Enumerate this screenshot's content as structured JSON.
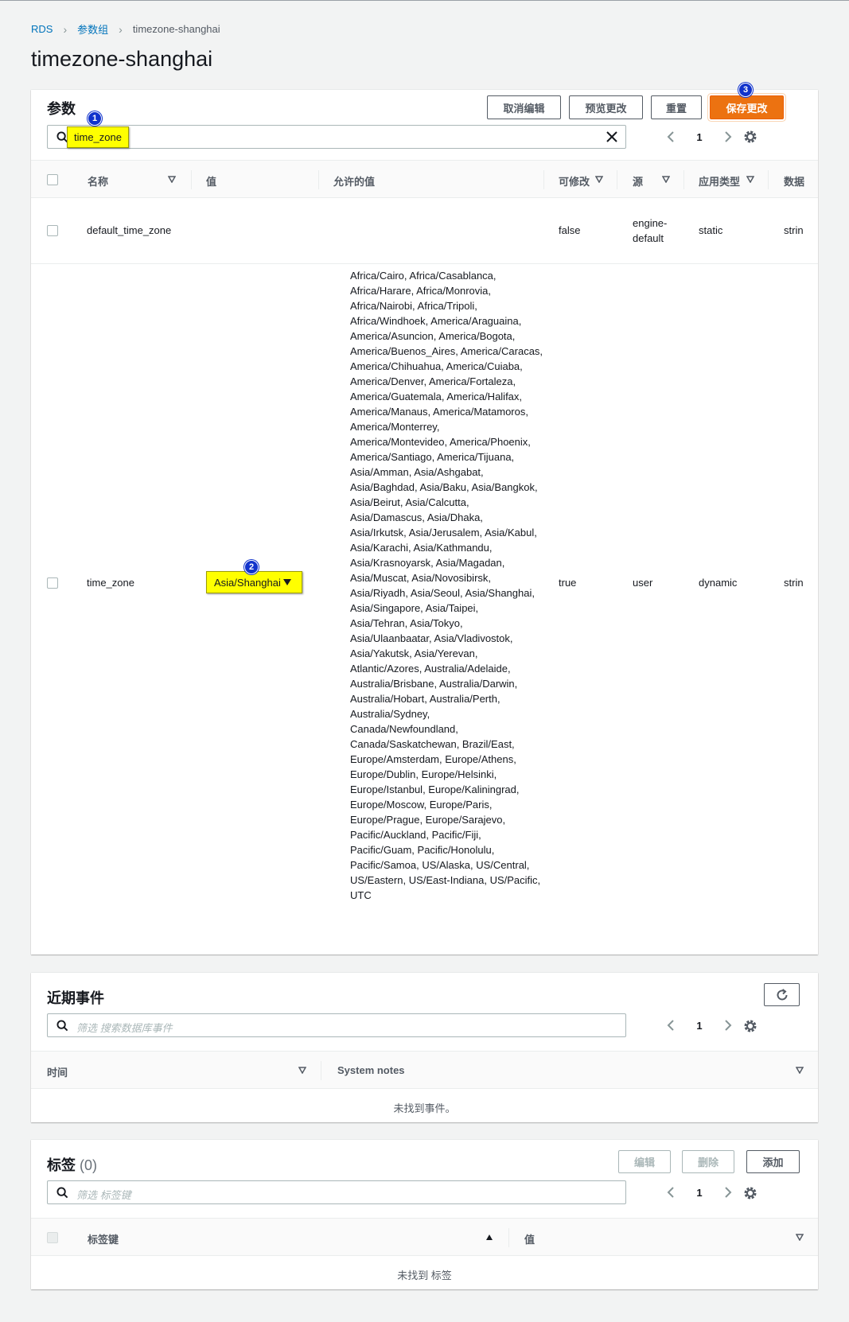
{
  "breadcrumb": {
    "root": "RDS",
    "parent": "参数组",
    "current": "timezone-shanghai"
  },
  "page_title": "timezone-shanghai",
  "params_panel": {
    "title": "参数",
    "buttons": {
      "cancel": "取消编辑",
      "preview": "预览更改",
      "reset": "重置",
      "save": "保存更改"
    },
    "search_value": "time_zone",
    "page": "1",
    "columns": [
      "名称",
      "值",
      "允许的值",
      "可修改",
      "源",
      "应用类型",
      "数据"
    ],
    "rows": [
      {
        "name": "default_time_zone",
        "value": "",
        "allowed": "",
        "modifiable": "false",
        "source_line1": "engine-",
        "source_line2": "default",
        "apply_type": "static",
        "data_type": "strin"
      },
      {
        "name": "time_zone",
        "value": "Asia/Shanghai",
        "modifiable": "true",
        "source": "user",
        "apply_type": "dynamic",
        "data_type": "strin",
        "allowed": "Africa/Cairo, Africa/Casablanca,\nAfrica/Harare, Africa/Monrovia,\nAfrica/Nairobi, Africa/Tripoli,\nAfrica/Windhoek, America/Araguaina,\nAmerica/Asuncion, America/Bogota,\nAmerica/Buenos_Aires, America/Caracas,\nAmerica/Chihuahua, America/Cuiaba,\nAmerica/Denver, America/Fortaleza,\nAmerica/Guatemala, America/Halifax,\nAmerica/Manaus, America/Matamoros,\nAmerica/Monterrey,\nAmerica/Montevideo, America/Phoenix,\nAmerica/Santiago, America/Tijuana,\nAsia/Amman, Asia/Ashgabat,\nAsia/Baghdad, Asia/Baku, Asia/Bangkok,\nAsia/Beirut, Asia/Calcutta,\nAsia/Damascus, Asia/Dhaka,\nAsia/Irkutsk, Asia/Jerusalem, Asia/Kabul,\nAsia/Karachi, Asia/Kathmandu,\nAsia/Krasnoyarsk, Asia/Magadan,\nAsia/Muscat, Asia/Novosibirsk,\nAsia/Riyadh, Asia/Seoul, Asia/Shanghai,\nAsia/Singapore, Asia/Taipei,\nAsia/Tehran, Asia/Tokyo,\nAsia/Ulaanbaatar, Asia/Vladivostok,\nAsia/Yakutsk, Asia/Yerevan,\nAtlantic/Azores, Australia/Adelaide,\nAustralia/Brisbane, Australia/Darwin,\nAustralia/Hobart, Australia/Perth,\nAustralia/Sydney,\nCanada/Newfoundland,\nCanada/Saskatchewan, Brazil/East,\nEurope/Amsterdam, Europe/Athens,\nEurope/Dublin, Europe/Helsinki,\nEurope/Istanbul, Europe/Kaliningrad,\nEurope/Moscow, Europe/Paris,\nEurope/Prague, Europe/Sarajevo,\nPacific/Auckland, Pacific/Fiji,\nPacific/Guam, Pacific/Honolulu,\nPacific/Samoa, US/Alaska, US/Central,\nUS/Eastern, US/East-Indiana, US/Pacific,\nUTC"
      }
    ]
  },
  "events_panel": {
    "title": "近期事件",
    "search_placeholder": "筛选 搜索数据库事件",
    "page": "1",
    "columns": [
      "时间",
      "System notes"
    ],
    "empty_text": "未找到事件。"
  },
  "tags_panel": {
    "title": "标签",
    "count": "(0)",
    "buttons": {
      "edit": "编辑",
      "delete": "删除",
      "add": "添加"
    },
    "search_placeholder": "筛选 标签键",
    "page": "1",
    "columns": [
      "标签键",
      "值"
    ],
    "empty_text": "未找到 标签"
  },
  "annotations": [
    "1",
    "2",
    "3"
  ],
  "colors": {
    "link": "#0073bb",
    "primary": "#ec7211",
    "highlight": "#ffff00",
    "badge": "#1133cc"
  },
  "icons": [
    "chevron-right-icon",
    "search-icon",
    "close-icon",
    "chevron-left-icon",
    "gear-icon",
    "sort-down-icon",
    "sort-up-icon",
    "refresh-icon",
    "caret-down-icon"
  ]
}
